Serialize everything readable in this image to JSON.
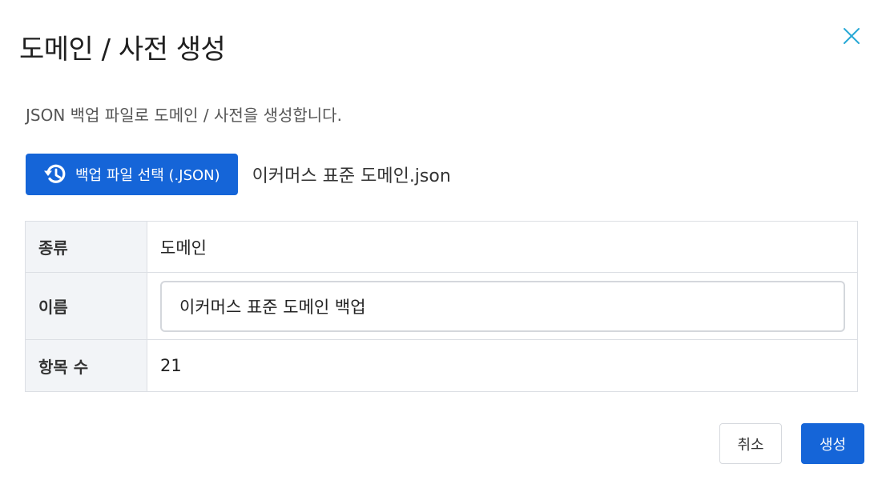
{
  "dialog": {
    "title": "도메인 / 사전 생성",
    "description": "JSON 백업 파일로 도메인 / 사전을 생성합니다.",
    "close_icon": "close-icon"
  },
  "file": {
    "button_label": "백업 파일 선택 (.JSON)",
    "button_icon": "history-icon",
    "selected_name": "이커머스 표준 도메인.json"
  },
  "info": {
    "kind_label": "종류",
    "kind_value": "도메인",
    "name_label": "이름",
    "name_value": "이커머스 표준 도메인 백업",
    "count_label": "항목 수",
    "count_value": "21"
  },
  "actions": {
    "cancel_label": "취소",
    "create_label": "생성"
  },
  "colors": {
    "primary": "#1565d8",
    "close_icon": "#29a9d6",
    "label_bg": "#f2f4f7",
    "border": "#dcdfe4"
  }
}
